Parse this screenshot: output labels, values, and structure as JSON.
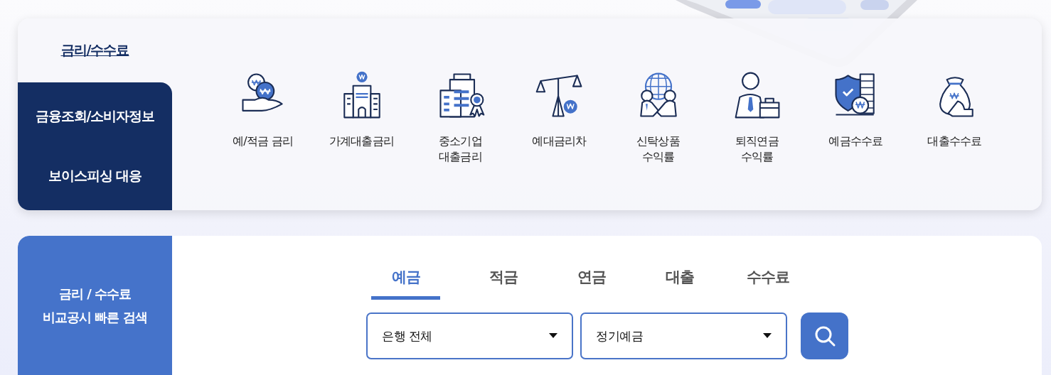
{
  "menu": {
    "items": [
      {
        "label": "금리/수수료",
        "selected": true
      },
      {
        "label": "금융조회/소비자정보",
        "selected": false
      },
      {
        "label": "보이스피싱 대응",
        "selected": false
      }
    ]
  },
  "shortcuts": [
    {
      "kind": "coins-hand",
      "label": "예/적금 금리"
    },
    {
      "kind": "building",
      "label": "가계대출금리"
    },
    {
      "kind": "office-award",
      "label": "중소기업\n대출금리"
    },
    {
      "kind": "scale",
      "label": "예대금리차"
    },
    {
      "kind": "handshake-globe",
      "label": "신탁상품\n수익률"
    },
    {
      "kind": "businessman",
      "label": "퇴직연금\n수익률"
    },
    {
      "kind": "shield-coins",
      "label": "예금수수료"
    },
    {
      "kind": "money-bag",
      "label": "대출수수료"
    }
  ],
  "quick_search": {
    "title": "금리 / 수수료\n비교공시 빠른 검색",
    "tabs": [
      {
        "label": "예금",
        "selected": true
      },
      {
        "label": "적금",
        "selected": false
      },
      {
        "label": "연금",
        "selected": false
      },
      {
        "label": "대출",
        "selected": false
      },
      {
        "label": "수수료",
        "selected": false
      }
    ],
    "dropdowns": [
      {
        "value": "은행 전체"
      },
      {
        "value": "정기예금"
      }
    ]
  }
}
